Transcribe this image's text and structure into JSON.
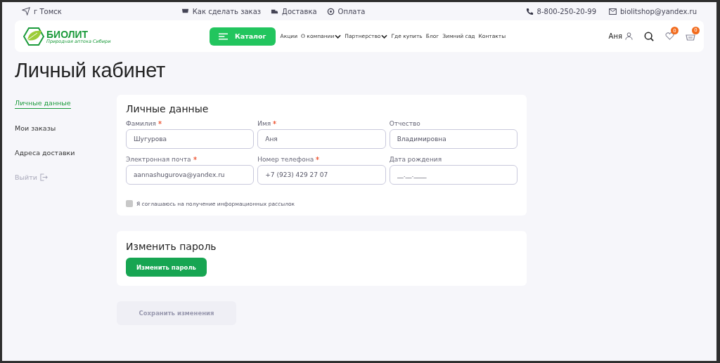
{
  "top_bar": {
    "city": "г Томск",
    "links": [
      {
        "label": "Как сделать заказ",
        "kind": "order"
      },
      {
        "label": "Доставка",
        "kind": "delivery"
      },
      {
        "label": "Оплата",
        "kind": "payment"
      }
    ],
    "phone": "8-800-250-20-99",
    "email": "biolitshop@yandex.ru"
  },
  "header": {
    "logo": {
      "name": "БИОЛИТ",
      "tagline": "Природная аптека Сибири"
    },
    "catalog_button": "Каталог",
    "nav": [
      {
        "label": "Акции",
        "has_dropdown": false
      },
      {
        "label": "О компании",
        "has_dropdown": true
      },
      {
        "label": "Партнерство",
        "has_dropdown": true
      },
      {
        "label": "Где купить",
        "has_dropdown": false
      },
      {
        "label": "Блог",
        "has_dropdown": false
      },
      {
        "label": "Зимний сад",
        "has_dropdown": false
      },
      {
        "label": "Контакты",
        "has_dropdown": false
      }
    ],
    "user": "Аня",
    "favorites_count": "0",
    "cart_count": "0"
  },
  "page_title": "Личный кабинет",
  "sidebar": [
    {
      "label": "Личные данные",
      "kind": "link",
      "selected": true
    },
    {
      "label": "Мои заказы",
      "kind": "link",
      "selected": false
    },
    {
      "label": "Адреса доставки",
      "kind": "link",
      "selected": false
    },
    {
      "label": "Выйти",
      "kind": "logout",
      "selected": false
    }
  ],
  "personal": {
    "title": "Личные данные",
    "fields": [
      {
        "label": "Фамилия",
        "required": true,
        "value": "Шугурова"
      },
      {
        "label": "Имя",
        "required": true,
        "value": "Аня"
      },
      {
        "label": "Отчество",
        "required": false,
        "value": "Владимировна"
      },
      {
        "label": "Электронная почта",
        "required": true,
        "value": "aannashugurova@yandex.ru"
      },
      {
        "label": "Номер телефона",
        "required": true,
        "value": "+7 (923) 429 27 07"
      },
      {
        "label": "Дата рождения",
        "required": false,
        "placeholder": "__.__.____"
      }
    ],
    "newsletter": {
      "label": "Я соглашаюсь на получение информационных рассылок",
      "checked": false
    }
  },
  "password": {
    "title": "Изменить пароль",
    "button": "Изменить пароль"
  },
  "save_button": {
    "label": "Сохранить изменения",
    "disabled": true
  }
}
